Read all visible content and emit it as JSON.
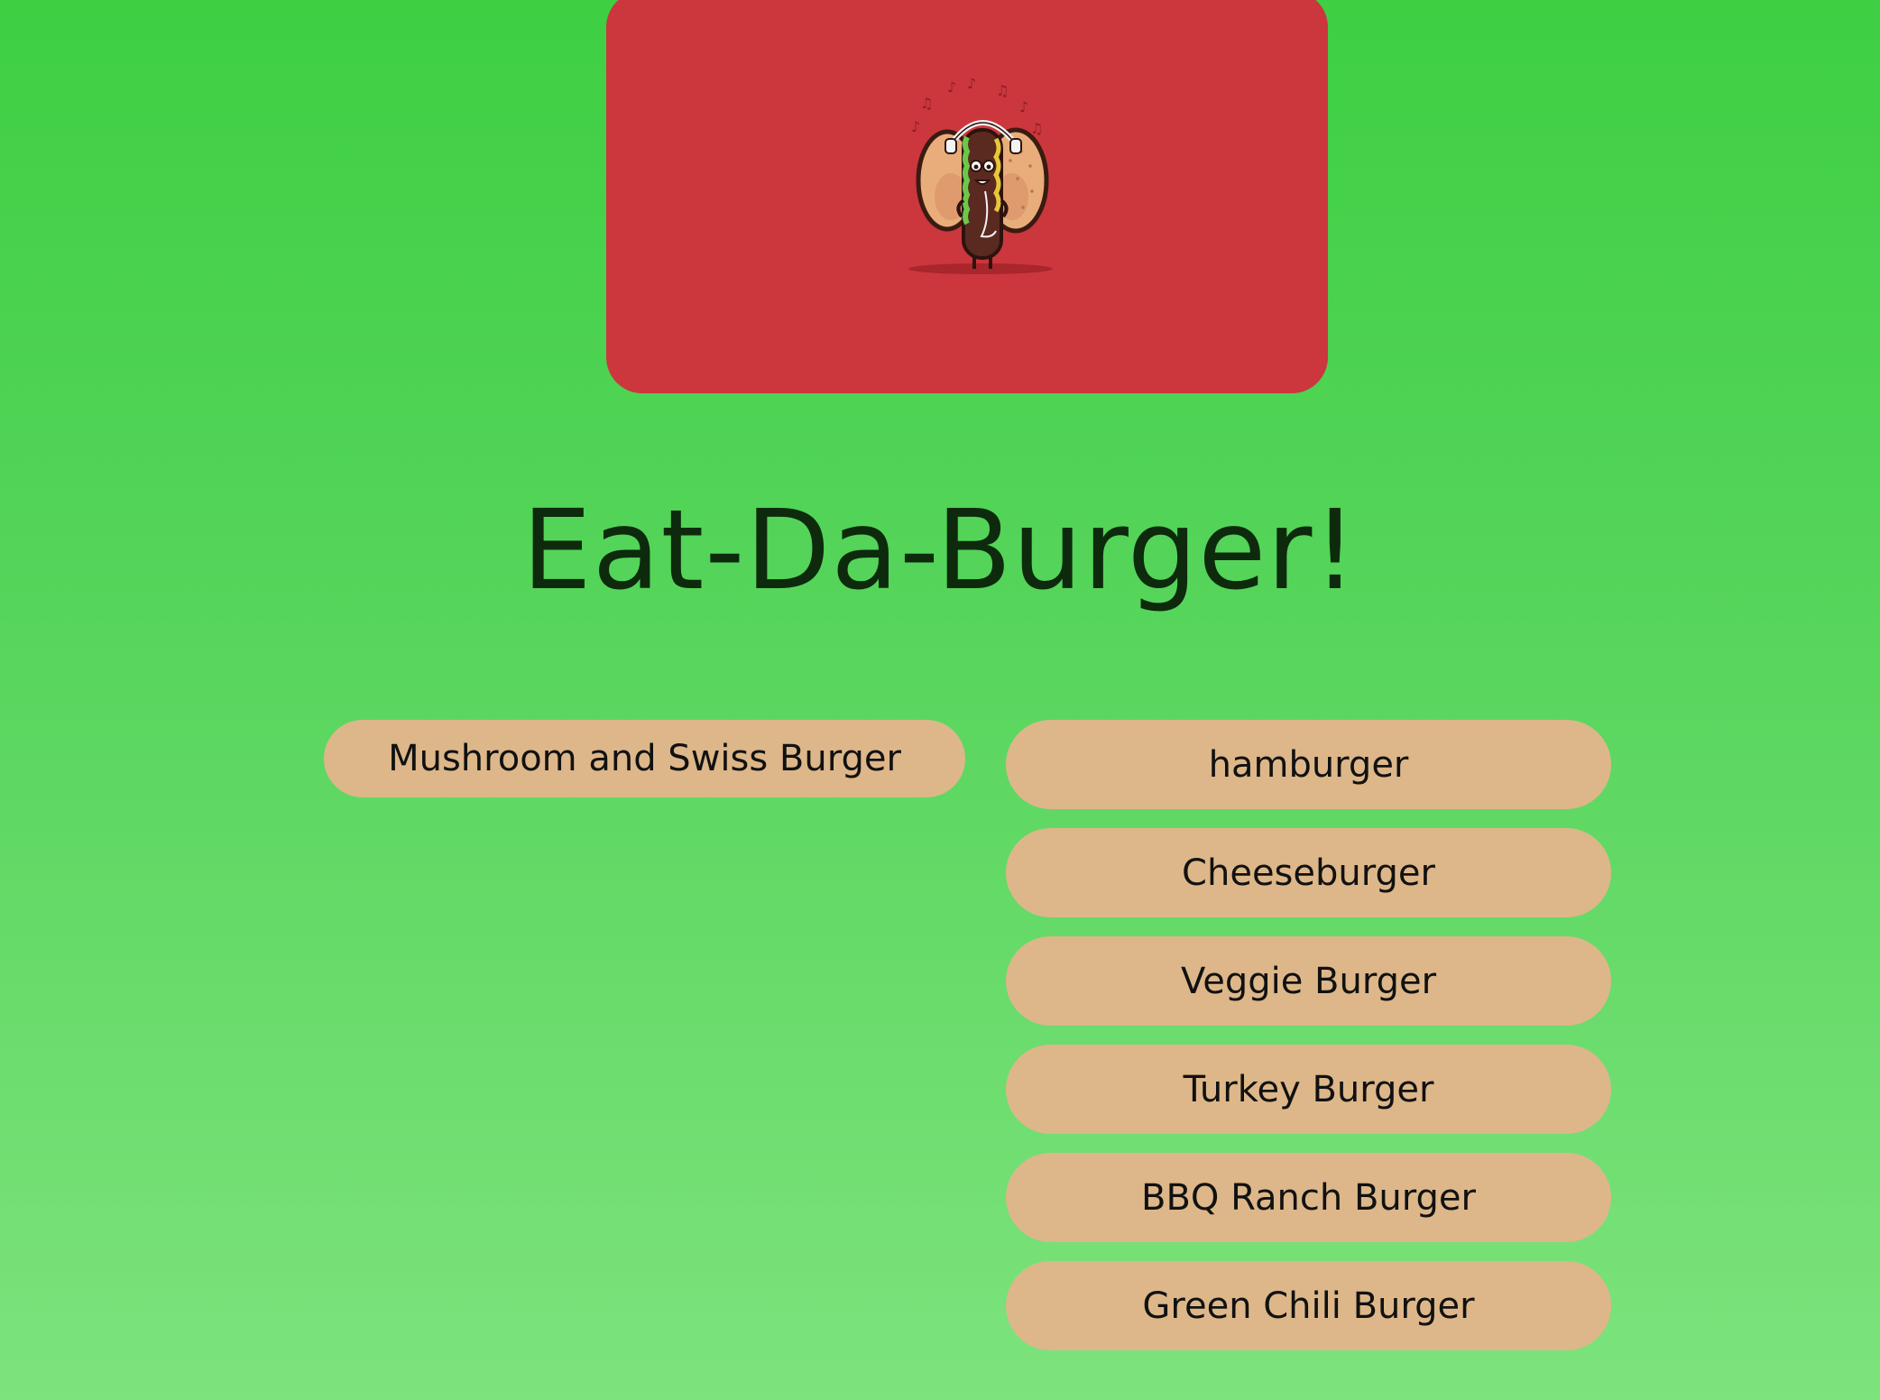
{
  "header": {
    "title": "Eat-Da-Burger!"
  },
  "devoured": {
    "items": [
      {
        "name": "Mushroom and Swiss Burger"
      }
    ]
  },
  "burgers": {
    "items": [
      {
        "name": "hamburger"
      },
      {
        "name": "Cheeseburger"
      },
      {
        "name": "Veggie Burger"
      },
      {
        "name": "Turkey Burger"
      },
      {
        "name": "BBQ Ranch Burger"
      },
      {
        "name": "Green Chili Burger"
      }
    ]
  },
  "colors": {
    "background_top": "#3ecf43",
    "background_bottom": "#7de37d",
    "hero_card": "#cc363d",
    "pill": "#ddb789",
    "title_text": "#0d2a0d"
  },
  "icons": {
    "mascot": "burger-mascot-with-headphones-icon"
  }
}
